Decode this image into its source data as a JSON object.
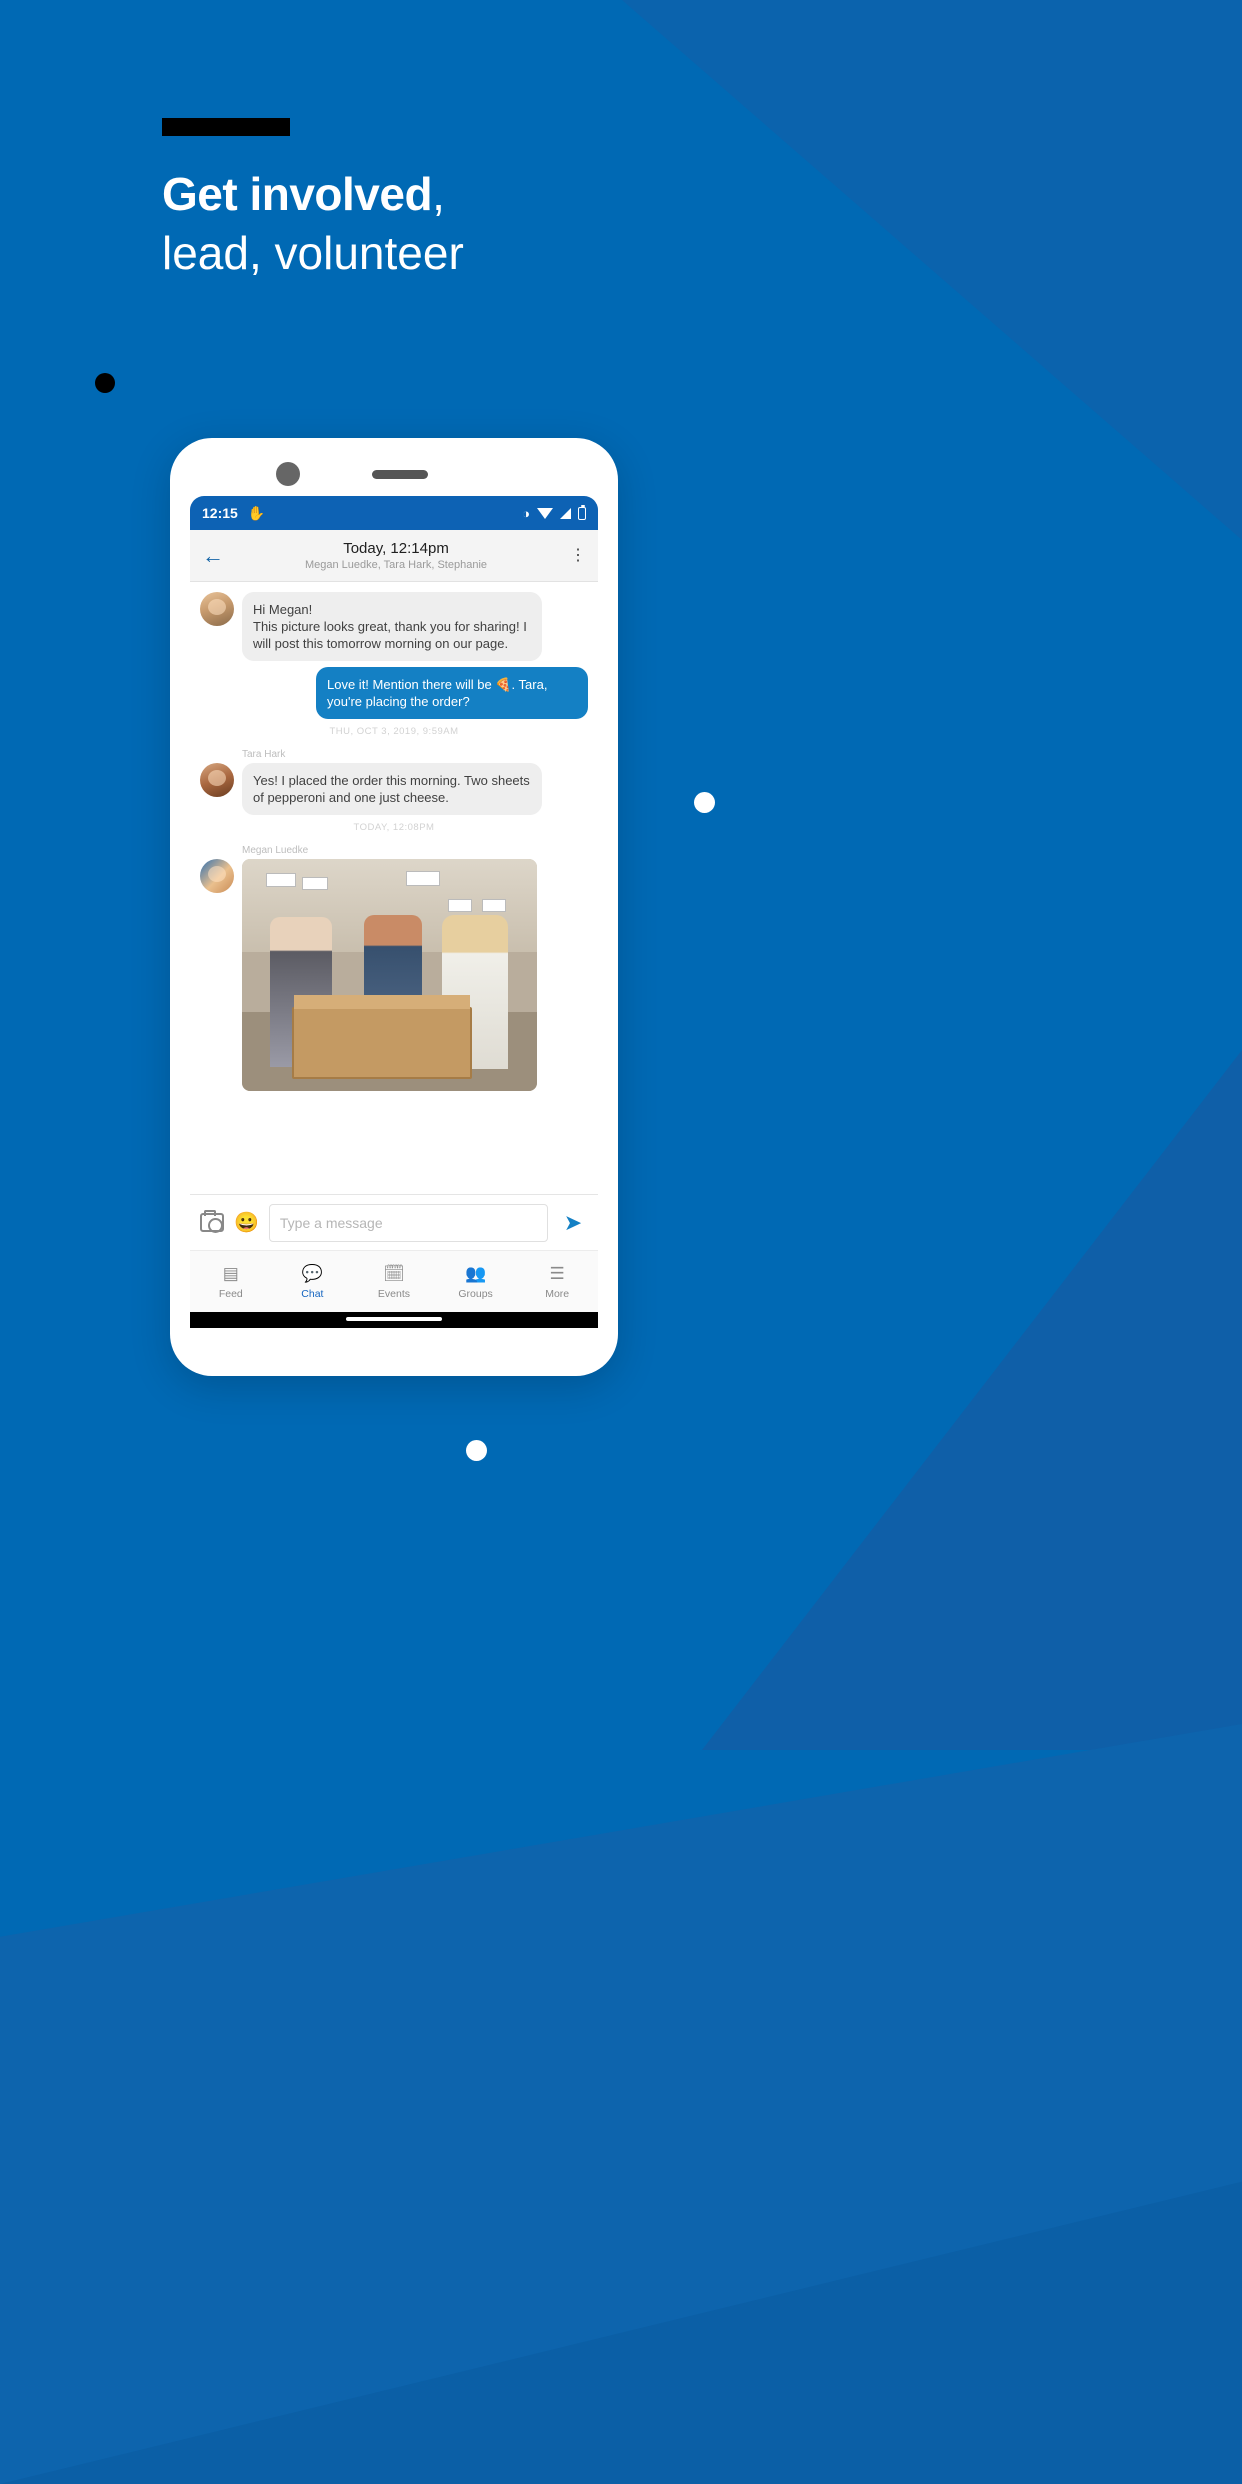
{
  "promo": {
    "background_color": "#0069b4",
    "redaction_bar": "",
    "headline_line1_bold": "Get involved",
    "headline_line1_comma": ",",
    "headline_line2": "lead, volunteer"
  },
  "phone": {
    "statusbar": {
      "time": "12:15",
      "hand_icon": "hand-icon",
      "vibrate_icon": "vibrate-icon",
      "wifi_icon": "wifi-icon",
      "signal_icon": "signal-icon",
      "battery_icon": "battery-icon"
    },
    "chat_header": {
      "back_icon": "back-arrow-icon",
      "title": "Today, 12:14pm",
      "subtitle": "Megan Luedke, Tara Hark, Stephanie",
      "overflow_icon": "kebab-menu-icon"
    },
    "messages": [
      {
        "id": "m1",
        "direction": "in",
        "sender": "",
        "text": "Hi Megan!\nThis picture looks great, thank you for sharing! I will post this tomorrow morning on our page."
      },
      {
        "id": "m2",
        "direction": "out",
        "sender": "",
        "text": "Love it! Mention there will be 🍕. Tara, you're placing the order?"
      },
      {
        "id": "m3",
        "direction": "in",
        "sender": "Tara Hark",
        "text": "Yes! I placed the order this morning.  Two sheets of pepperoni and one just cheese."
      },
      {
        "id": "m4",
        "direction": "in",
        "sender": "Megan Luedke",
        "text": ""
      }
    ],
    "timestamps": {
      "t1": "THU, OCT 3, 2019, 9:59AM",
      "t2": "TODAY, 12:08PM"
    },
    "composer": {
      "camera_icon": "camera-icon",
      "emoji_icon": "emoji-icon",
      "placeholder": "Type a message",
      "value": "",
      "send_icon": "send-icon"
    },
    "bottom_nav": [
      {
        "label": "Feed",
        "icon": "feed-icon",
        "active": false
      },
      {
        "label": "Chat",
        "icon": "chat-icon",
        "active": true
      },
      {
        "label": "Events",
        "icon": "events-icon",
        "active": false
      },
      {
        "label": "Groups",
        "icon": "groups-icon",
        "active": false
      },
      {
        "label": "More",
        "icon": "more-icon",
        "active": false
      }
    ]
  },
  "colors": {
    "brand_blue": "#0069b4",
    "status_blue": "#0d62b4",
    "bubble_out": "#1480c4",
    "bubble_in": "#eeeeee",
    "accent": "#1565c0"
  }
}
